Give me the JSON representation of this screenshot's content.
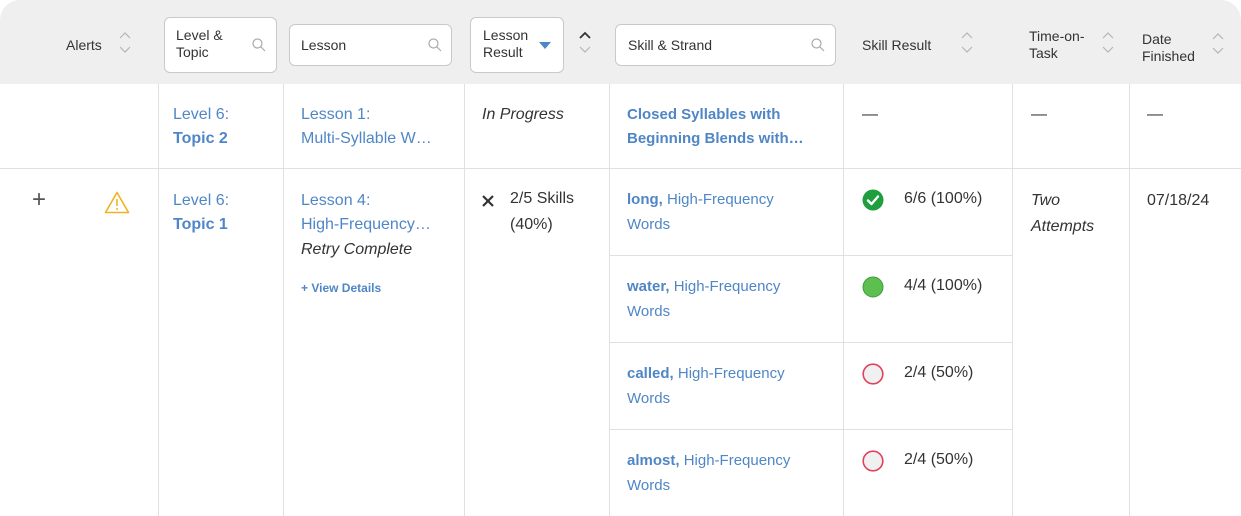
{
  "header": {
    "alerts": "Alerts",
    "level_topic_line1": "Level &",
    "level_topic_line2": "Topic",
    "lesson": "Lesson",
    "lesson_result_line1": "Lesson",
    "lesson_result_line2": "Result",
    "skill_strand": "Skill & Strand",
    "skill_result": "Skill Result",
    "time_on_task_line1": "Time-on-",
    "time_on_task_line2": "Task",
    "date_finished_line1": "Date",
    "date_finished_line2": "Finished"
  },
  "rows": [
    {
      "level": "Level 6:",
      "topic": "Topic 2",
      "lesson_line1": "Lesson 1:",
      "lesson_line2": "Multi-Syllable W…",
      "result": "In Progress",
      "skill_line1": "Closed Syllables with",
      "skill_line2": "Beginning Blends with…",
      "skill_result": "—",
      "time": "—",
      "date": "—"
    },
    {
      "expand": "+",
      "level": "Level 6:",
      "topic": "Topic 1",
      "lesson_line1": "Lesson 4:",
      "lesson_line2": "High-Frequency…",
      "lesson_status": "Retry Complete",
      "view_details": "+ View Details",
      "result_line1": "2/5 Skills",
      "result_line2": "(40%)",
      "time_line1": "Two",
      "time_line2": "Attempts",
      "date": "07/18/24",
      "skills": [
        {
          "word": "long,",
          "strand_a": "High-Frequency",
          "strand_b": "Words",
          "result": "6/6 (100%)",
          "status": "check"
        },
        {
          "word": "water,",
          "strand_a": "High-Frequency",
          "strand_b": "Words",
          "result": "4/4 (100%)",
          "status": "filled"
        },
        {
          "word": "called,",
          "strand_a": "High-Frequency",
          "strand_b": "Words",
          "result": "2/4 (50%)",
          "status": "empty"
        },
        {
          "word": "almost,",
          "strand_a": "High-Frequency",
          "strand_b": "Words",
          "result": "2/4 (50%)",
          "status": "empty"
        }
      ]
    }
  ],
  "icons": {
    "sort": "sort-icon",
    "search": "search-icon",
    "alert": "warning-icon",
    "fail": "x-icon",
    "check": "check-circle-icon",
    "filled": "filled-circle-icon",
    "empty": "empty-circle-icon"
  },
  "colors": {
    "link": "#4f86c6",
    "alert": "#f0b323",
    "check": "#1e9e3e",
    "filled": "#5cbf4f",
    "empty": "#e0415b"
  }
}
